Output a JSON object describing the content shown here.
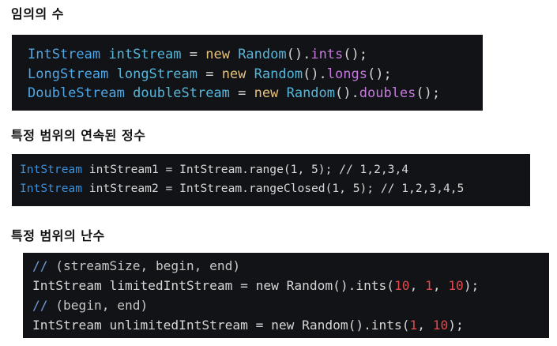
{
  "headings": {
    "random": "임의의 수",
    "range": "특정 범위의 연속된 정수",
    "random_range": "특정 범위의 난수"
  },
  "block1": {
    "line1": [
      {
        "t": "IntStream",
        "k": "type"
      },
      {
        "t": " ",
        "k": "plain"
      },
      {
        "t": "intStream",
        "k": "var"
      },
      {
        "t": " = ",
        "k": "punct"
      },
      {
        "t": "new",
        "k": "new"
      },
      {
        "t": " ",
        "k": "plain"
      },
      {
        "t": "Random",
        "k": "var"
      },
      {
        "t": "().",
        "k": "punct"
      },
      {
        "t": "ints",
        "k": "method"
      },
      {
        "t": "();",
        "k": "punct"
      }
    ],
    "line2": [
      {
        "t": "LongStream",
        "k": "type"
      },
      {
        "t": " ",
        "k": "plain"
      },
      {
        "t": "longStream",
        "k": "var"
      },
      {
        "t": " = ",
        "k": "punct"
      },
      {
        "t": "new",
        "k": "new"
      },
      {
        "t": " ",
        "k": "plain"
      },
      {
        "t": "Random",
        "k": "var"
      },
      {
        "t": "().",
        "k": "punct"
      },
      {
        "t": "longs",
        "k": "method"
      },
      {
        "t": "();",
        "k": "punct"
      }
    ],
    "line3": [
      {
        "t": "DoubleStream",
        "k": "type"
      },
      {
        "t": " ",
        "k": "plain"
      },
      {
        "t": "doubleStream",
        "k": "var"
      },
      {
        "t": " = ",
        "k": "punct"
      },
      {
        "t": "new",
        "k": "new"
      },
      {
        "t": " ",
        "k": "plain"
      },
      {
        "t": "Random",
        "k": "var"
      },
      {
        "t": "().",
        "k": "punct"
      },
      {
        "t": "doubles",
        "k": "method"
      },
      {
        "t": "();",
        "k": "punct"
      }
    ]
  },
  "block2": {
    "line1": [
      {
        "t": "IntStream",
        "k": "type-b2"
      },
      {
        "t": " intStream1 = IntStream.range(1, 5); // 1,2,3,4",
        "k": "plain"
      }
    ],
    "line2": [
      {
        "t": "IntStream",
        "k": "type-b2"
      },
      {
        "t": " intStream2 = IntStream.rangeClosed(1, 5); // 1,2,3,4,5",
        "k": "plain"
      }
    ]
  },
  "block3": {
    "line1": [
      {
        "t": "//",
        "k": "comment-slash"
      },
      {
        "t": " (streamSize, begin, end)",
        "k": "comment"
      }
    ],
    "line2": [
      {
        "t": "IntStream limitedIntStream = new Random().ints(",
        "k": "plain"
      },
      {
        "t": "10",
        "k": "num"
      },
      {
        "t": ", ",
        "k": "plain"
      },
      {
        "t": "1",
        "k": "num"
      },
      {
        "t": ", ",
        "k": "plain"
      },
      {
        "t": "10",
        "k": "num"
      },
      {
        "t": ");",
        "k": "plain"
      }
    ],
    "line3": [
      {
        "t": "//",
        "k": "comment-slash"
      },
      {
        "t": " (begin, end)",
        "k": "comment"
      }
    ],
    "line4": [
      {
        "t": "IntStream unlimitedIntStream = new Random().ints(",
        "k": "plain"
      },
      {
        "t": "1",
        "k": "num"
      },
      {
        "t": ", ",
        "k": "plain"
      },
      {
        "t": "10",
        "k": "num"
      },
      {
        "t": ");",
        "k": "plain"
      }
    ]
  },
  "colors": {
    "code_background": "#111317",
    "type": "#4ea7e6",
    "keyword_new": "#e5c07b",
    "method": "#c678dd",
    "number": "#e24a4a"
  }
}
